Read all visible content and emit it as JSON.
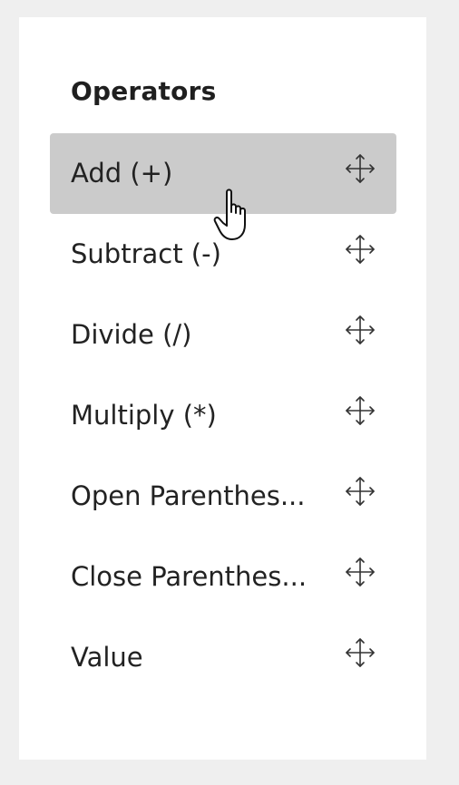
{
  "panel": {
    "title": "Operators",
    "background": "#ffffff",
    "active_item_background": "#cbcbcb"
  },
  "operators": [
    {
      "label": "Add (+)",
      "icon": "move-icon",
      "active": true
    },
    {
      "label": "Subtract (-)",
      "icon": "move-icon",
      "active": false
    },
    {
      "label": "Divide (/)",
      "icon": "move-icon",
      "active": false
    },
    {
      "label": "Multiply (*)",
      "icon": "move-icon",
      "active": false
    },
    {
      "label": "Open Parenthes...",
      "icon": "move-icon",
      "active": false
    },
    {
      "label": "Close Parenthes...",
      "icon": "move-icon",
      "active": false
    },
    {
      "label": "Value",
      "icon": "move-icon",
      "active": false
    }
  ],
  "cursor": {
    "icon": "hand-pointer-icon"
  }
}
